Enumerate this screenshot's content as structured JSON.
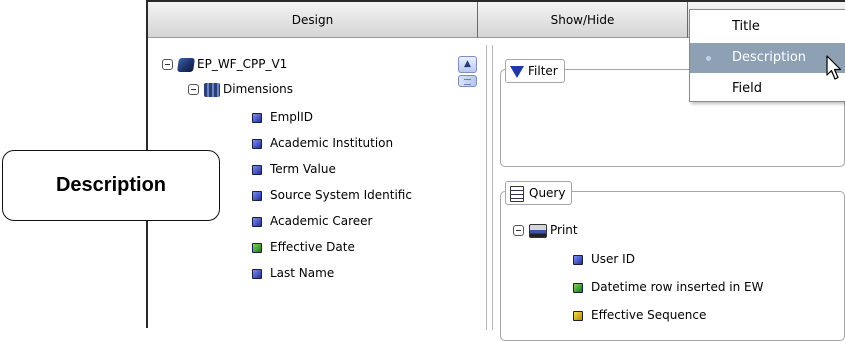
{
  "tabs": {
    "design": "Design",
    "show_hide": "Show/Hide"
  },
  "tree": {
    "root": "EP_WF_CPP_V1",
    "dimensions": "Dimensions",
    "fields": [
      {
        "label": "EmplID",
        "color": "blue"
      },
      {
        "label": "Academic Institution",
        "color": "blue"
      },
      {
        "label": "Term Value",
        "color": "blue"
      },
      {
        "label": "Source System Identific",
        "color": "blue"
      },
      {
        "label": "Academic Career",
        "color": "blue"
      },
      {
        "label": "Effective Date",
        "color": "green"
      },
      {
        "label": "Last Name",
        "color": "blue"
      }
    ]
  },
  "filter": {
    "title": "Filter"
  },
  "query": {
    "title": "Query",
    "print": "Print",
    "fields": [
      {
        "label": "User ID",
        "color": "blue"
      },
      {
        "label": "Datetime row inserted in EW",
        "color": "green"
      },
      {
        "label": "Effective Sequence",
        "color": "yellow"
      }
    ]
  },
  "menu": {
    "items": [
      "Title",
      "Description",
      "Field"
    ],
    "selected": "Description"
  },
  "callout": {
    "text": "Description"
  },
  "colors": {
    "menu_highlight": "#8ea0b4",
    "icon_blue": "#1e2f9c",
    "icon_green": "#1e7a18",
    "icon_yellow": "#b08b00"
  }
}
